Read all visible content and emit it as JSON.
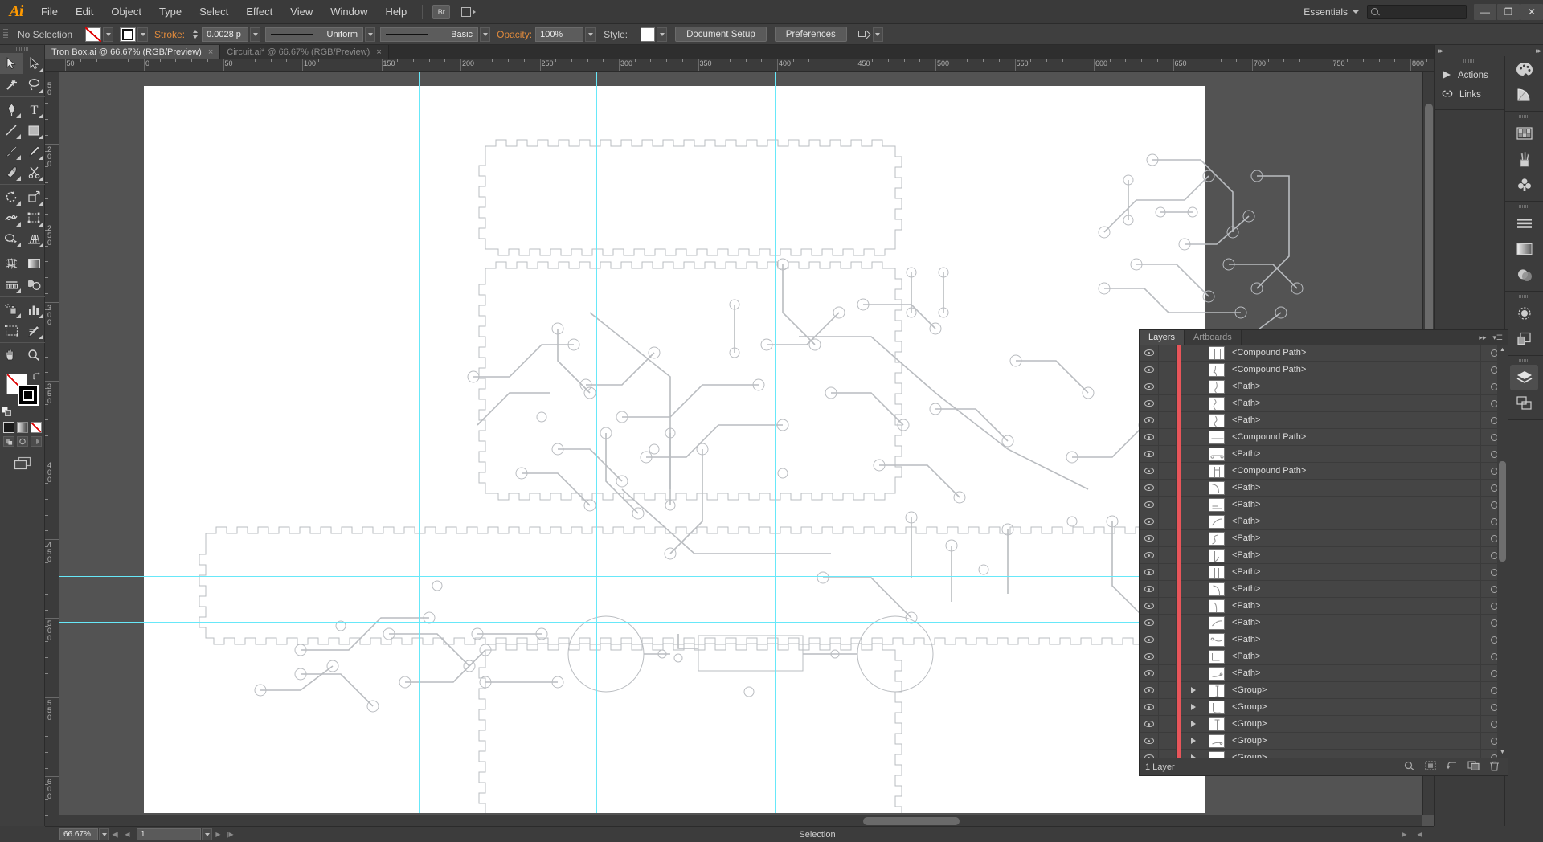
{
  "app": {
    "name": "Adobe Illustrator",
    "logo": "Ai"
  },
  "menubar": {
    "items": [
      "File",
      "Edit",
      "Object",
      "Type",
      "Select",
      "Effect",
      "View",
      "Window",
      "Help"
    ],
    "bridge_label": "Br",
    "workspace": "Essentials",
    "search_placeholder": "",
    "window_buttons": {
      "minimize": "—",
      "restore": "❐",
      "close": "✕"
    }
  },
  "controlbar": {
    "selection_status": "No Selection",
    "stroke_label": "Stroke:",
    "stroke_weight": "0.0028 p",
    "profile": "Uniform",
    "brush": "Basic",
    "opacity_label": "Opacity:",
    "opacity_value": "100%",
    "style_label": "Style:",
    "document_setup": "Document Setup",
    "preferences": "Preferences"
  },
  "tabs": [
    {
      "title": "Tron Box.ai @ 66.67% (RGB/Preview)",
      "active": true,
      "close": "×"
    },
    {
      "title": "Circuit.ai* @ 66.67% (RGB/Preview)",
      "active": false,
      "close": "×"
    }
  ],
  "toolbar": {
    "tools": [
      "selection-tool",
      "direct-selection-tool",
      "magic-wand-tool",
      "lasso-tool",
      "pen-tool",
      "type-tool",
      "line-segment-tool",
      "rectangle-tool",
      "paintbrush-tool",
      "pencil-tool",
      "blob-brush-tool",
      "scissors-tool",
      "rotate-tool",
      "scale-tool",
      "width-tool",
      "free-transform-tool",
      "shape-builder-tool",
      "perspective-grid-tool",
      "mesh-tool",
      "gradient-tool",
      "eyedropper-tool",
      "blend-tool",
      "symbol-sprayer-tool",
      "column-graph-tool",
      "artboard-tool",
      "slice-tool",
      "hand-tool",
      "zoom-tool"
    ],
    "active_tool": "selection-tool",
    "fill": "none",
    "stroke": "#000000"
  },
  "rulers": {
    "unit": "px",
    "h_labels": [
      "50",
      "0",
      "50",
      "100",
      "150",
      "200",
      "250",
      "300",
      "350",
      "400",
      "450",
      "500",
      "550",
      "600",
      "650",
      "700",
      "750",
      "800"
    ],
    "v_labels": [
      "50",
      "200",
      "250",
      "300",
      "350",
      "400",
      "450",
      "500",
      "550",
      "600"
    ]
  },
  "canvas": {
    "zoom": "66.67%",
    "guide_color": "#67e8f9",
    "artwork_name": "circuit-board-artwork"
  },
  "statusbar": {
    "zoom": "66.67%",
    "page": "1",
    "status": "Selection"
  },
  "right_dock": {
    "panels": [
      {
        "label": "Actions",
        "icon": "play-icon"
      },
      {
        "label": "Links",
        "icon": "link-icon"
      }
    ],
    "rail_icons": [
      "color-palette-icon",
      "color-guide-icon",
      "swatches-icon",
      "brushes-icon",
      "symbols-icon",
      "stroke-icon",
      "gradient-icon",
      "transparency-icon",
      "appearance-icon",
      "graphic-styles-icon",
      "layers-icon",
      "artboards-icon"
    ],
    "active_rail_icon": "layers-icon"
  },
  "layers_panel": {
    "tabs": [
      {
        "label": "Layers",
        "active": true
      },
      {
        "label": "Artboards",
        "active": false
      }
    ],
    "color_marker": "#e8555a",
    "rows": [
      {
        "name": "<Compound Path>",
        "type": "compound-path",
        "expandable": false
      },
      {
        "name": "<Compound Path>",
        "type": "compound-path",
        "expandable": false
      },
      {
        "name": "<Path>",
        "type": "path",
        "expandable": false
      },
      {
        "name": "<Path>",
        "type": "path",
        "expandable": false
      },
      {
        "name": "<Path>",
        "type": "path",
        "expandable": false
      },
      {
        "name": "<Compound Path>",
        "type": "compound-path",
        "expandable": false
      },
      {
        "name": "<Path>",
        "type": "path",
        "expandable": false
      },
      {
        "name": "<Compound Path>",
        "type": "compound-path",
        "expandable": false
      },
      {
        "name": "<Path>",
        "type": "path",
        "expandable": false
      },
      {
        "name": "<Path>",
        "type": "path",
        "expandable": false
      },
      {
        "name": "<Path>",
        "type": "path",
        "expandable": false
      },
      {
        "name": "<Path>",
        "type": "path",
        "expandable": false
      },
      {
        "name": "<Path>",
        "type": "path",
        "expandable": false
      },
      {
        "name": "<Path>",
        "type": "path",
        "expandable": false
      },
      {
        "name": "<Path>",
        "type": "path",
        "expandable": false
      },
      {
        "name": "<Path>",
        "type": "path",
        "expandable": false
      },
      {
        "name": "<Path>",
        "type": "path",
        "expandable": false
      },
      {
        "name": "<Path>",
        "type": "path",
        "expandable": false
      },
      {
        "name": "<Path>",
        "type": "path",
        "expandable": false
      },
      {
        "name": "<Path>",
        "type": "path",
        "expandable": false
      },
      {
        "name": "<Group>",
        "type": "group",
        "expandable": true
      },
      {
        "name": "<Group>",
        "type": "group",
        "expandable": true
      },
      {
        "name": "<Group>",
        "type": "group",
        "expandable": true
      },
      {
        "name": "<Group>",
        "type": "group",
        "expandable": true
      },
      {
        "name": "<Group>",
        "type": "group",
        "expandable": true
      }
    ],
    "footer": {
      "count_label": "1 Layer",
      "buttons": [
        "locate-object-icon",
        "make-clipping-mask-icon",
        "create-sublayer-icon",
        "create-layer-icon",
        "delete-selection-icon"
      ]
    }
  }
}
